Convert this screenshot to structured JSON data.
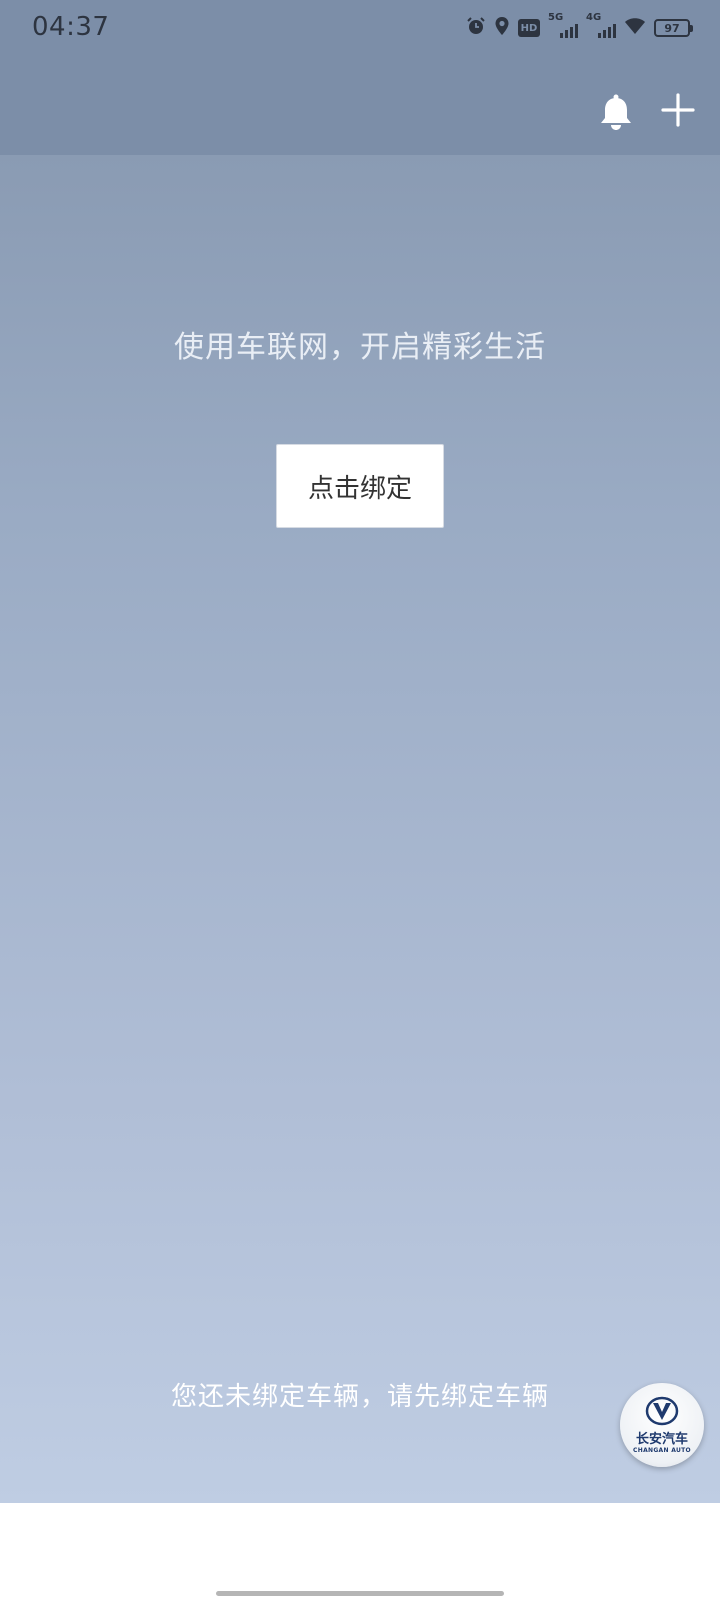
{
  "status_bar": {
    "time": "04:37",
    "hd_label": "HD",
    "network_1": "5G",
    "network_2": "4G",
    "battery": "97"
  },
  "header": {
    "notification_icon": "bell-icon",
    "add_icon": "plus-icon"
  },
  "main": {
    "headline": "使用车联网，开启精彩生活",
    "bind_button_label": "点击绑定",
    "notice": "您还未绑定车辆，请先绑定车辆"
  },
  "brand": {
    "name_cn": "长安汽车",
    "name_en": "CHANGAN AUTO"
  },
  "colors": {
    "header_bg": "#7c8ea8",
    "gradient_bottom": "#bfcde3",
    "brand_blue": "#1f3a6e"
  }
}
